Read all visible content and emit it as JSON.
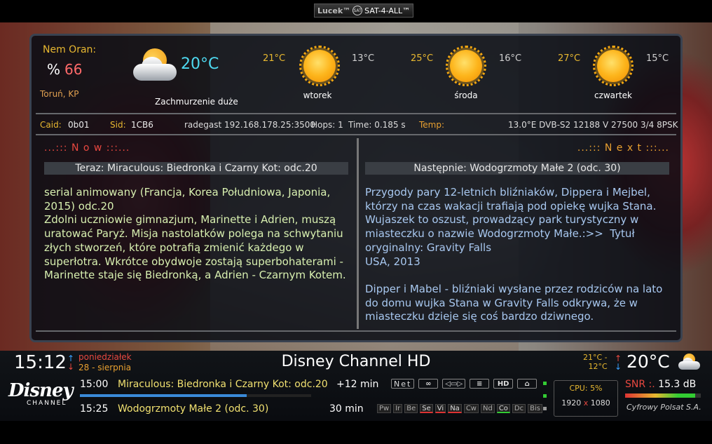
{
  "topbar": {
    "brand_text": "Lucek™",
    "sat_logo": "SAT",
    "brand_suffix": "SAT-4-ALL™"
  },
  "weather": {
    "city_label": "Nem Oran:",
    "humidity_symbol": "%",
    "humidity_value": "66",
    "location": "Toruń, KP",
    "current_temp": "20°C",
    "current_desc": "Zachmurzenie duże",
    "current_icon": "partly-cloudy-icon",
    "forecast": [
      {
        "day": "wtorek",
        "hi": "21°C",
        "lo": "13°C",
        "icon": "sun-icon"
      },
      {
        "day": "środa",
        "hi": "25°C",
        "lo": "16°C",
        "icon": "sun-icon"
      },
      {
        "day": "czwartek",
        "hi": "27°C",
        "lo": "15°C",
        "icon": "sun-icon"
      }
    ]
  },
  "info": {
    "caid_label": "Caid:",
    "caid_value": "0b01",
    "sid_label": "Sid:",
    "sid_value": "1CB6",
    "server": "radegast 192.168.178.25:3500",
    "hops": "Hops: 1",
    "time": "Time: 0.185 s",
    "temp_label": "Temp:",
    "tuner": "13.0°E  DVB-S2  12188  V 27500 3/4 8PSK"
  },
  "epg": {
    "now_header": "...::: N o w :::...",
    "next_header": "...::: N e x t :::...",
    "now_title": "Teraz: Miraculous: Biedronka i Czarny Kot: odc.20",
    "next_title": "Następnie: Wodogrzmoty Małe 2 (odc. 30)",
    "now_desc": "serial animowany (Francja, Korea Południowa, Japonia,\n2015) odc.20\nZdolni uczniowie gimnazjum, Marinette i Adrien, muszą\nuratować Paryż. Misja nastolatków polega na schwytaniu\nzłych stworzeń, które potrafią zmienić każdego w\nsuperłotra. Wkrótce obydwoje zostają superbohaterami -\nMarinette staje się Biedronką, a Adrien - Czarnym Kotem.",
    "next_desc": "Przygody pary 12-letnich bliźniaków, Dippera i Mejbel,\nktórzy na czas wakacji trafiają pod opiekę wujka Stana.\nWujaszek to oszust, prowadzący park turystyczny w\nmiasteczku o nazwie Wodogrzmoty Małe.:>>  Tytuł\noryginalny: Gravity Falls\nUSA, 2013\n\nDipper i Mabel - bliźniaki wysłane przez rodziców na lato\ndo domu wujka Stana w Gravity Falls odkrywa, że w\nmiasteczku dzieje się coś bardzo dziwnego."
  },
  "infobar": {
    "clock": "15:12",
    "day": "poniedziałek",
    "date": "28 - sierpnia",
    "channel": "Disney Channel HD",
    "temp_hi": "21°C -",
    "temp_lo": "12°C",
    "temp_now": "20°C",
    "logo_big": "Disney",
    "logo_small": "CHANNEL",
    "events": [
      {
        "time": "15:00",
        "title": "Miraculous: Biedronka i Czarny Kot: odc.20",
        "remaining": "+12 min"
      },
      {
        "time": "15:25",
        "title": "Wodogrzmoty Małe 2 (odc. 30)",
        "remaining": "30 min"
      }
    ],
    "progress": 0.72,
    "icons": [
      "Net",
      "∞",
      "◁▭▷",
      "≡",
      "HD",
      "⌂"
    ],
    "flags": [
      "Pw",
      "Ir",
      "Be",
      "Se",
      "Vi",
      "Na",
      "Cw",
      "Nd",
      "Co",
      "Dc",
      "Bis"
    ],
    "cpu_label": "CPU:",
    "cpu_value": "5%",
    "res_w": "1920",
    "res_x": "x",
    "res_h": "1080",
    "snr_label": "SNR :.",
    "snr_value": "15.3 dB",
    "snr_level": 0.93,
    "provider": "Cyfrowy Polsat S.A.",
    "colors": {
      "accent_red": "#e84840",
      "accent_orange": "#e8a030",
      "accent_yellow": "#e8b830",
      "cyan": "#4ed9f0"
    }
  }
}
